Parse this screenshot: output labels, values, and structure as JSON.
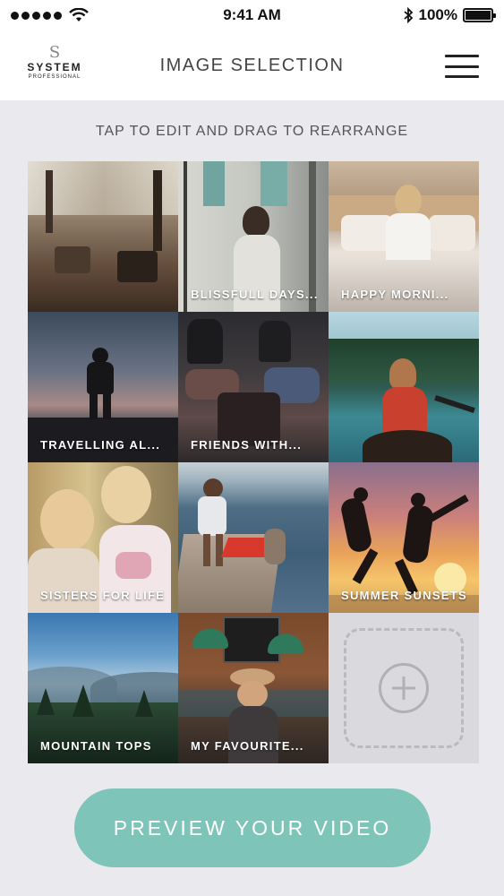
{
  "status_bar": {
    "time": "9:41 AM",
    "battery_text": "100%",
    "battery_level": 1.0,
    "icons": [
      "signal-dots-icon",
      "wifi-icon",
      "bluetooth-icon",
      "battery-icon"
    ]
  },
  "header": {
    "logo": {
      "name": "SYSTEM",
      "sub": "PROFESSIONAL"
    },
    "title": "IMAGE SELECTION",
    "menu_icon": "hamburger-menu-icon"
  },
  "instruction": "TAP TO EDIT AND DRAG TO REARRANGE",
  "tiles": [
    {
      "caption": "",
      "scene": "cafe-interior"
    },
    {
      "caption": "BLISSFULL DAYS...",
      "scene": "woman-at-window"
    },
    {
      "caption": "HAPPY MORNI...",
      "scene": "woman-on-bed"
    },
    {
      "caption": "TRAVELLING AL...",
      "scene": "man-at-dusk"
    },
    {
      "caption": "FRIENDS WITH...",
      "scene": "friends-on-car"
    },
    {
      "caption": "",
      "scene": "woman-in-canoe"
    },
    {
      "caption": "SISTERS FOR LIFE",
      "scene": "two-girls"
    },
    {
      "caption": "",
      "scene": "friends-on-pier"
    },
    {
      "caption": "SUMMER SUNSETS",
      "scene": "jumping-silhouettes"
    },
    {
      "caption": "MOUNTAIN TOPS",
      "scene": "mountain-landscape"
    },
    {
      "caption": "MY FAVOURITE...",
      "scene": "coffee-shop"
    }
  ],
  "add_tile_icon": "add-plus-icon",
  "preview_button": "PREVIEW YOUR VIDEO",
  "colors": {
    "accent": "#7ec4b8",
    "background": "#e9e9ee",
    "header": "#ffffff"
  }
}
